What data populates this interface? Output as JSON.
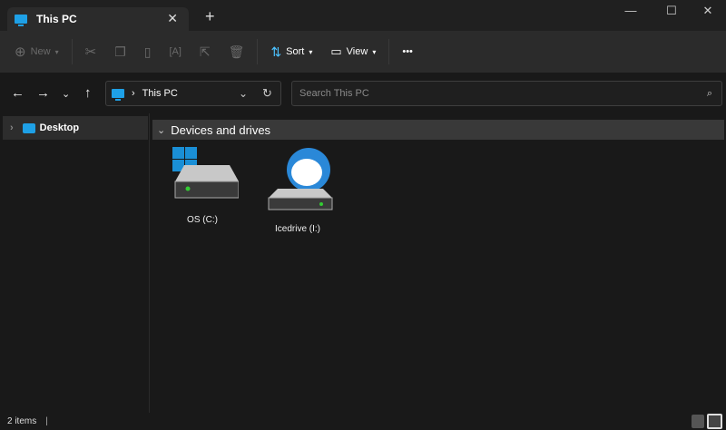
{
  "tab": {
    "title": "This PC",
    "icon": "monitor-icon"
  },
  "window": {
    "minimize": "—",
    "maximize": "☐",
    "close": "✕",
    "new_tab": "+"
  },
  "toolbar": {
    "new_label": "New",
    "sort_label": "Sort",
    "view_label": "View",
    "more": "•••"
  },
  "address": {
    "path": "This PC",
    "search_placeholder": "Search This PC"
  },
  "nav_pane": {
    "items": [
      {
        "label": "Desktop"
      }
    ]
  },
  "content": {
    "group": "Devices and drives",
    "drives": [
      {
        "label": "OS (C:)"
      },
      {
        "label": "Icedrive (I:)"
      }
    ]
  },
  "status": {
    "items": "2 items"
  }
}
